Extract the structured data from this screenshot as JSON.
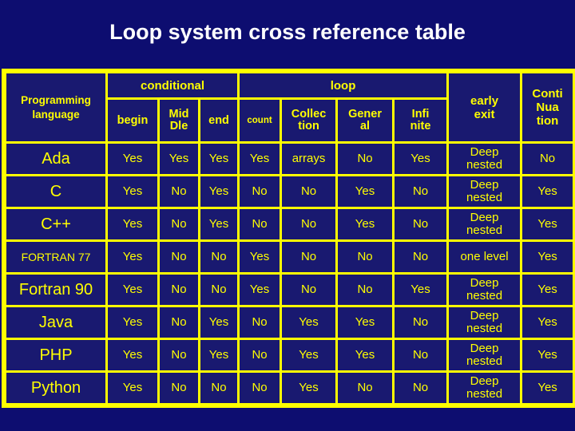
{
  "slide": {
    "title": "Loop system cross reference table",
    "background_color": "#0d0d70",
    "grid_color": "#ffff00",
    "cell_color": "#191970",
    "header_text_color": "#ffff00",
    "language_text_color": "#ffffff",
    "value_text_color": "#90ee90"
  },
  "table": {
    "row_header_label_line1": "Programming",
    "row_header_label_line2": "language",
    "groups": [
      {
        "label": "conditional",
        "span": 3
      },
      {
        "label": "loop",
        "span": 4
      }
    ],
    "standalone_headers": [
      {
        "line1": "early",
        "line2": "exit"
      },
      {
        "line1": "Conti",
        "line2": "Nua",
        "line3": "tion"
      }
    ],
    "columns": [
      "begin",
      "Mid\nDle",
      "end",
      "count",
      "Collec\ntion",
      "Gener\nal",
      "Infi\nnite"
    ],
    "column_labels": {
      "begin": "begin",
      "middle_l1": "Mid",
      "middle_l2": "Dle",
      "end": "end",
      "count": "count",
      "collection_l1": "Collec",
      "collection_l2": "tion",
      "general_l1": "Gener",
      "general_l2": "al",
      "infinite_l1": "Infi",
      "infinite_l2": "nite",
      "early_l1": "early",
      "early_l2": "exit",
      "conti_l1": "Conti",
      "conti_l2": "Nua",
      "conti_l3": "tion"
    },
    "rows": [
      {
        "language": "Ada",
        "begin": "Yes",
        "middle": "Yes",
        "end": "Yes",
        "count": "Yes",
        "collection": "arrays",
        "general": "No",
        "infinite": "Yes",
        "early_exit_l1": "Deep",
        "early_exit_l2": "nested",
        "continuation": "No"
      },
      {
        "language": "C",
        "begin": "Yes",
        "middle": "No",
        "end": "Yes",
        "count": "No",
        "collection": "No",
        "general": "Yes",
        "infinite": "No",
        "early_exit_l1": "Deep",
        "early_exit_l2": "nested",
        "continuation": "Yes"
      },
      {
        "language": "C++",
        "begin": "Yes",
        "middle": "No",
        "end": "Yes",
        "count": "No",
        "collection": "No",
        "general": "Yes",
        "infinite": "No",
        "early_exit_l1": "Deep",
        "early_exit_l2": "nested",
        "continuation": "Yes"
      },
      {
        "language": "FORTRAN 77",
        "begin": "Yes",
        "middle": "No",
        "end": "No",
        "count": "Yes",
        "collection": "No",
        "general": "No",
        "infinite": "No",
        "early_exit_l1": "one level",
        "early_exit_l2": "",
        "continuation": "Yes"
      },
      {
        "language": "Fortran 90",
        "begin": "Yes",
        "middle": "No",
        "end": "No",
        "count": "Yes",
        "collection": "No",
        "general": "No",
        "infinite": "Yes",
        "early_exit_l1": "Deep",
        "early_exit_l2": "nested",
        "continuation": "Yes"
      },
      {
        "language": "Java",
        "begin": "Yes",
        "middle": "No",
        "end": "Yes",
        "count": "No",
        "collection": "Yes",
        "general": "Yes",
        "infinite": "No",
        "early_exit_l1": "Deep",
        "early_exit_l2": "nested",
        "continuation": "Yes"
      },
      {
        "language": "PHP",
        "begin": "Yes",
        "middle": "No",
        "end": "Yes",
        "count": "No",
        "collection": "Yes",
        "general": "Yes",
        "infinite": "No",
        "early_exit_l1": "Deep",
        "early_exit_l2": "nested",
        "continuation": "Yes"
      },
      {
        "language": "Python",
        "begin": "Yes",
        "middle": "No",
        "end": "No",
        "count": "No",
        "collection": "Yes",
        "general": "No",
        "infinite": "No",
        "early_exit_l1": "Deep",
        "early_exit_l2": "nested",
        "continuation": "Yes"
      }
    ]
  }
}
